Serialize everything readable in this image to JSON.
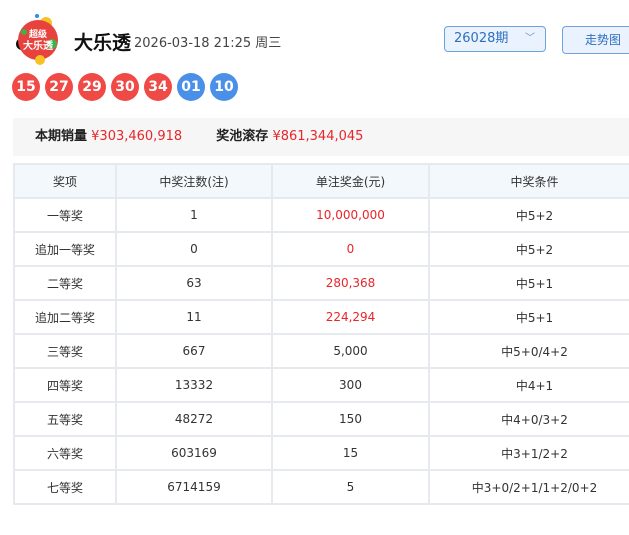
{
  "header": {
    "logo_text": "超级大乐透",
    "title": "大乐透",
    "datetime": "2026-03-18 21:25 周三",
    "issue_select": "26028期",
    "trend_button": "走势图"
  },
  "balls": {
    "front": [
      "15",
      "27",
      "29",
      "30",
      "34"
    ],
    "back": [
      "01",
      "10"
    ],
    "front_color": "#ef4a46",
    "back_color": "#4a90e8"
  },
  "summary": {
    "sales_label": "本期销量",
    "sales_value": "¥303,460,918",
    "pool_label": "奖池滚存",
    "pool_value": "¥861,344,045"
  },
  "table": {
    "headers": [
      "奖项",
      "中奖注数(注)",
      "单注奖金(元)",
      "中奖条件"
    ],
    "rows": [
      {
        "level": "一等奖",
        "count": "1",
        "prize": "10,000,000",
        "cond": "中5+2",
        "red": true
      },
      {
        "level": "追加一等奖",
        "count": "0",
        "prize": "0",
        "cond": "中5+2",
        "red": true
      },
      {
        "level": "二等奖",
        "count": "63",
        "prize": "280,368",
        "cond": "中5+1",
        "red": true
      },
      {
        "level": "追加二等奖",
        "count": "11",
        "prize": "224,294",
        "cond": "中5+1",
        "red": true
      },
      {
        "level": "三等奖",
        "count": "667",
        "prize": "5,000",
        "cond": "中5+0/4+2",
        "red": false
      },
      {
        "level": "四等奖",
        "count": "13332",
        "prize": "300",
        "cond": "中4+1",
        "red": false
      },
      {
        "level": "五等奖",
        "count": "48272",
        "prize": "150",
        "cond": "中4+0/3+2",
        "red": false
      },
      {
        "level": "六等奖",
        "count": "603169",
        "prize": "15",
        "cond": "中3+1/2+2",
        "red": false
      },
      {
        "level": "七等奖",
        "count": "6714159",
        "prize": "5",
        "cond": "中3+0/2+1/1+2/0+2",
        "red": false
      }
    ]
  }
}
